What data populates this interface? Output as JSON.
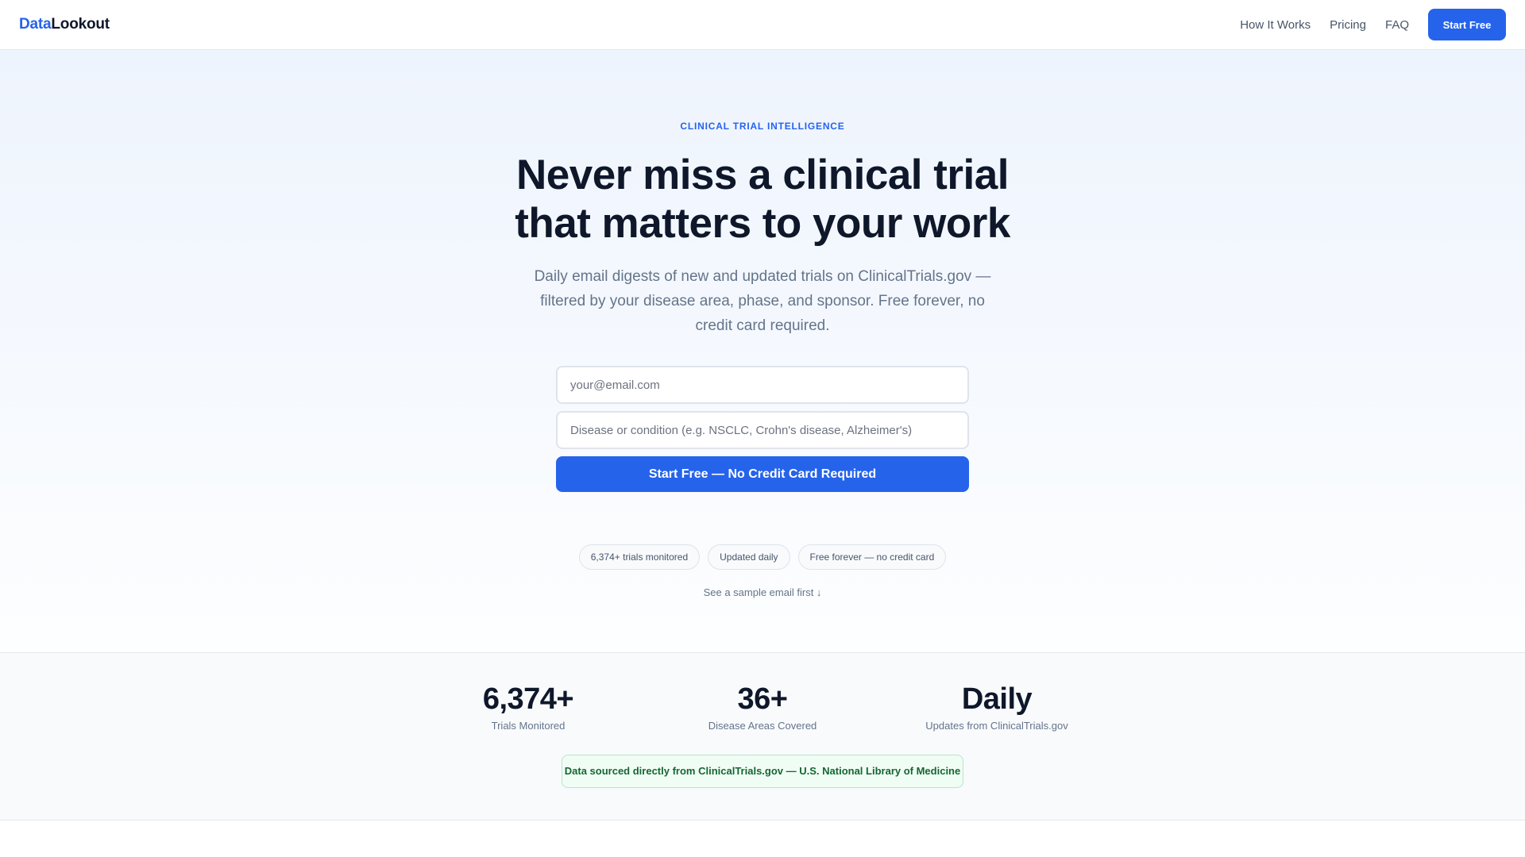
{
  "header": {
    "logo_part1": "Data",
    "logo_part2": "Lookout",
    "nav": [
      {
        "label": "How It Works"
      },
      {
        "label": "Pricing"
      },
      {
        "label": "FAQ"
      }
    ],
    "cta_label": "Start Free"
  },
  "hero": {
    "eyebrow": "CLINICAL TRIAL INTELLIGENCE",
    "headline_line1": "Never miss a clinical trial",
    "headline_line2": "that matters to your work",
    "subhead": "Daily email digests of new and updated trials on ClinicalTrials.gov — filtered by your disease area, phase, and sponsor. Free forever, no credit card required.",
    "form": {
      "email_placeholder": "your@email.com",
      "email_value": "",
      "condition_placeholder": "Disease or condition (e.g. NSCLC, Crohn's disease, Alzheimer's)",
      "condition_value": "",
      "submit_label": "Start Free — No Credit Card Required"
    },
    "pills": [
      {
        "label": "6,374+ trials monitored"
      },
      {
        "label": "Updated daily"
      },
      {
        "label": "Free forever — no credit card"
      }
    ],
    "sample_link": "See a sample email first ↓"
  },
  "stats": {
    "items": [
      {
        "value": "6,374+",
        "label": "Trials Monitored"
      },
      {
        "value": "36+",
        "label": "Disease Areas Covered"
      },
      {
        "value": "Daily",
        "label": "Updates from ClinicalTrials.gov"
      }
    ],
    "source_note": "Data sourced directly from ClinicalTrials.gov — U.S. National Library of Medicine"
  },
  "colors": {
    "brand": "#2563eb",
    "text": "#0f172a",
    "muted": "#64748b",
    "success_bg": "#f0fdf4",
    "success_text": "#166534"
  }
}
